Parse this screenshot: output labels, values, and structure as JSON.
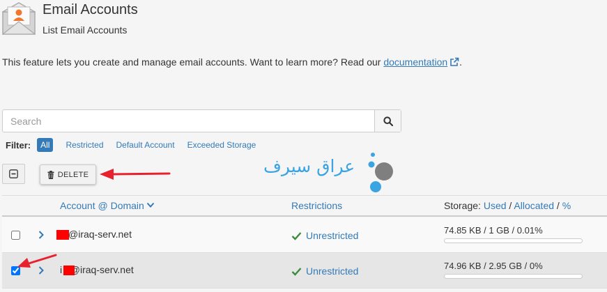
{
  "header": {
    "title": "Email Accounts",
    "subtitle": "List Email Accounts",
    "icon": "envelope-user-icon"
  },
  "intro": {
    "text": "This feature lets you create and manage email accounts. Want to learn more? Read our ",
    "link_label": "documentation",
    "suffix": "."
  },
  "search": {
    "placeholder": "Search",
    "value": "",
    "button_icon": "search-icon"
  },
  "filter": {
    "label": "Filter:",
    "options": [
      {
        "label": "All",
        "active": true
      },
      {
        "label": "Restricted",
        "active": false
      },
      {
        "label": "Default Account",
        "active": false
      },
      {
        "label": "Exceeded Storage",
        "active": false
      }
    ]
  },
  "actions": {
    "select_all_icon": "minus-square-icon",
    "delete_label": "DELETE"
  },
  "watermark": {
    "text": "عراق سيرف"
  },
  "table": {
    "headers": {
      "account": "Account @ Domain",
      "restrictions": "Restrictions",
      "storage_prefix": "Storage: ",
      "storage_used": "Used",
      "sep1": " / ",
      "storage_allocated": "Allocated",
      "sep2": " / ",
      "storage_percent": "%"
    },
    "rows": [
      {
        "checked": false,
        "email": "@iraq-serv.net",
        "restriction": "Unrestricted",
        "storage": "74.85 KB / 1 GB / 0.01%",
        "usage_fraction": 0.0001
      },
      {
        "checked": true,
        "email": "i    o@iraq-serv.net",
        "restriction": "Unrestricted",
        "storage": "74.96 KB / 2.95 GB / 0%",
        "usage_fraction": 0
      }
    ]
  },
  "colors": {
    "accent": "#337ab7",
    "annotation": "#e8212e",
    "redaction": "#ff0000",
    "watermark": "#3aa3e2",
    "success": "#3c8a3c"
  }
}
